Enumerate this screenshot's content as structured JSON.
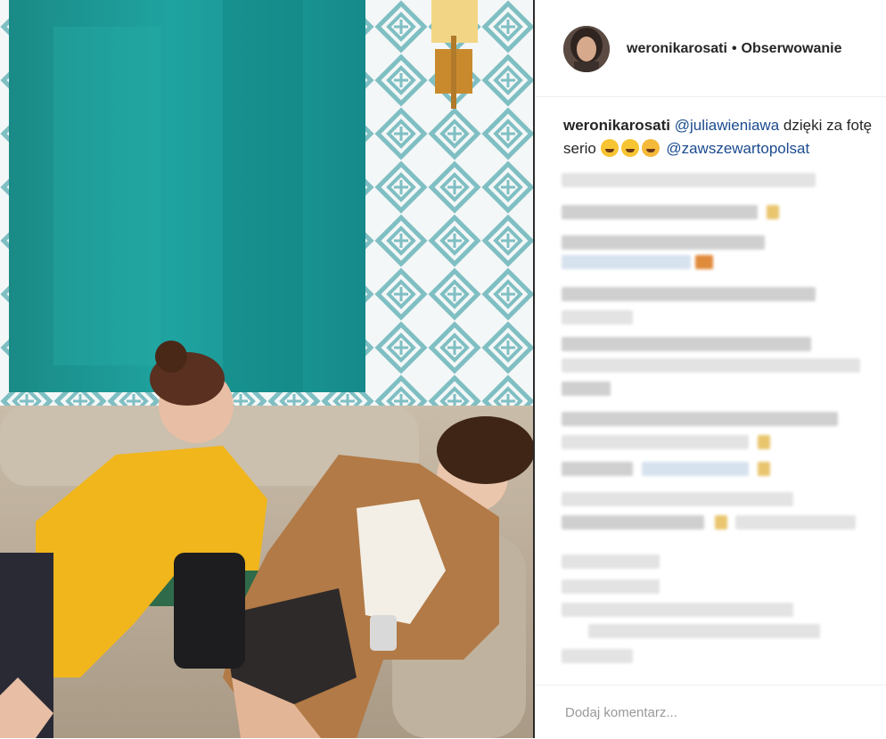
{
  "post": {
    "photo_alt": "Two women sitting on a sofa in front of a teal painting and patterned wallpaper"
  },
  "header": {
    "username": "weronikarosati",
    "separator": "•",
    "follow_label": "Obserwowanie"
  },
  "caption": {
    "username": "weronikarosati",
    "mention_1": "@juliawieniawa",
    "text_1": "dzięki za fotę serio",
    "emojis": [
      "face-with-tears-of-joy",
      "face-with-tears-of-joy",
      "face-with-tongue"
    ],
    "mention_2": "@zawszewartopolsat"
  },
  "add_comment": {
    "placeholder": "Dodaj komentarz..."
  },
  "colors": {
    "text": "#262626",
    "mention": "#1b4b8f",
    "placeholder": "#999999",
    "divider": "#efefef"
  }
}
